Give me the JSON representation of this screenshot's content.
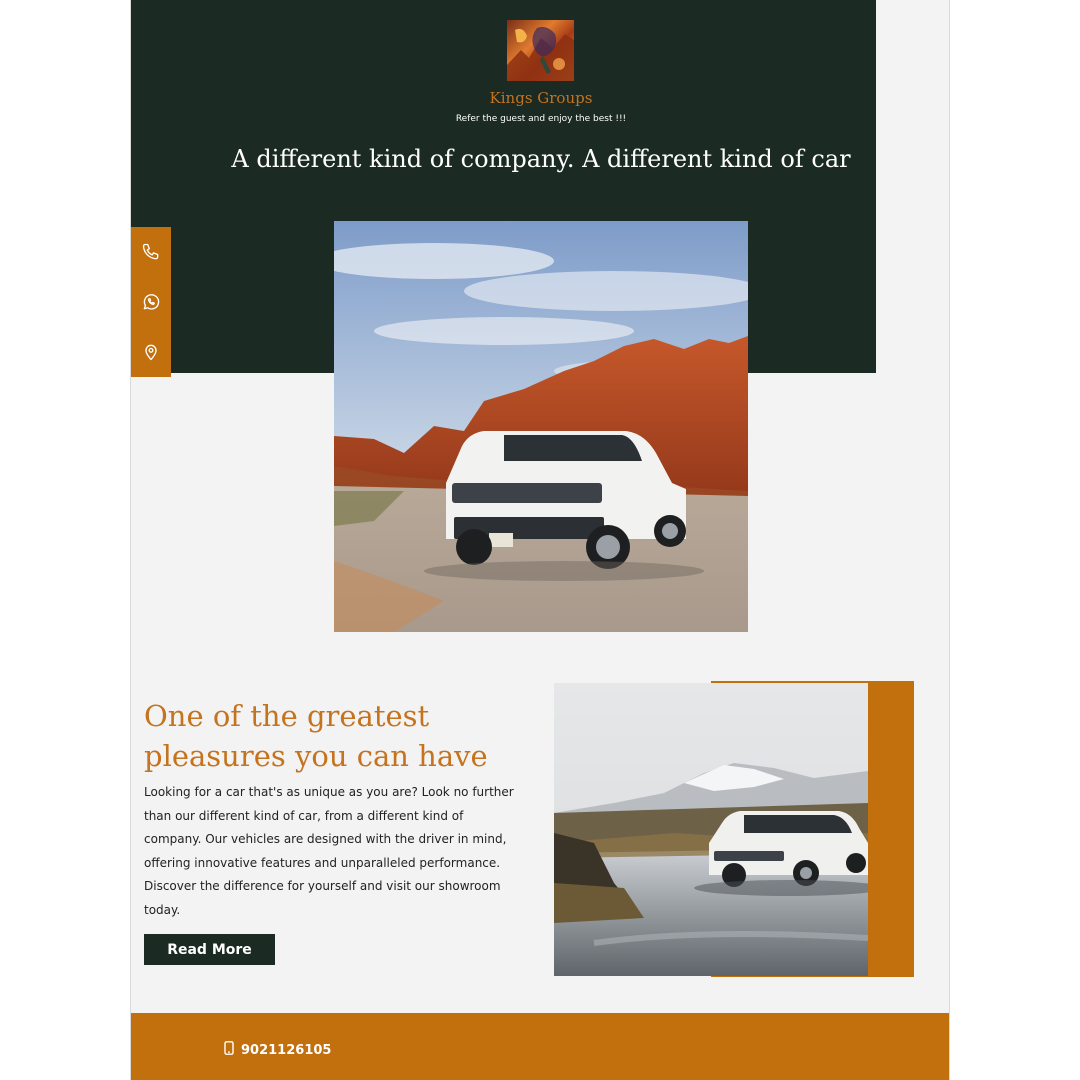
{
  "brand": {
    "name": "Kings Groups",
    "tagline": "Refer the guest and enjoy the best !!!"
  },
  "hero": {
    "headline": "A different kind of company. A different kind of car"
  },
  "contact_icons": [
    "phone-icon",
    "whatsapp-icon",
    "location-pin-icon"
  ],
  "feature": {
    "title_line1": "One of the greatest",
    "title_line2": "pleasures you can have",
    "body_lines": [
      "Looking for a car that's as unique as you are? Look no further",
      "than our different kind of car, from a different kind of",
      "company. Our vehicles are designed with the driver in mind,",
      "offering innovative features and unparalleled performance.",
      "Discover the difference for yourself and visit our showroom",
      "today."
    ],
    "button_label": "Read More"
  },
  "footer": {
    "phone": "9021126105"
  },
  "colors": {
    "dark_green": "#1b2a22",
    "accent_orange": "#c26f0e",
    "heading_orange": "#c5731e",
    "page_bg": "#f3f3f3"
  }
}
